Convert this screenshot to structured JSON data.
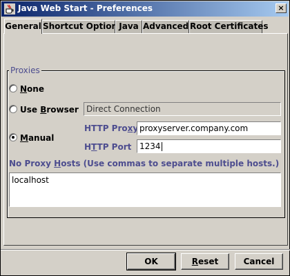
{
  "window": {
    "title": "Java Web Start - Preferences",
    "app_icon": "java-cup-icon",
    "close_glyph": "×"
  },
  "tabs": [
    {
      "label": "General",
      "selected": true
    },
    {
      "label": "Shortcut Options",
      "selected": false
    },
    {
      "label": "Java",
      "selected": false
    },
    {
      "label": "Advanced",
      "selected": false
    },
    {
      "label": "Root Certificates",
      "selected": false
    }
  ],
  "proxies": {
    "group_title": "Proxies",
    "selected": "Manual",
    "options": {
      "none": {
        "label_pre": "",
        "mnemonic": "N",
        "label_post": "one"
      },
      "browser": {
        "label_pre": "Use ",
        "mnemonic": "B",
        "label_post": "rowser"
      },
      "manual": {
        "label_pre": "",
        "mnemonic": "M",
        "label_post": "anual"
      }
    },
    "browser_value": "Direct Connection",
    "http_proxy": {
      "label_pre": "HTTP Pro",
      "mnemonic": "x",
      "label_post": "y",
      "value": "proxyserver.company.com"
    },
    "http_port": {
      "label_pre": "H",
      "mnemonic": "T",
      "label_post": "TP Port",
      "value": "1234"
    },
    "no_proxy": {
      "label_pre": "No Proxy ",
      "mnemonic": "H",
      "label_post": "osts (Use commas to separate multiple hosts.)",
      "value": "localhost"
    }
  },
  "buttons": {
    "ok": "OK",
    "reset_mnemonic": "R",
    "reset_rest": "eset",
    "cancel": "Cancel"
  },
  "colors": {
    "titlebar_start": "#0a246a",
    "titlebar_end": "#a6caf0",
    "label_accent": "#4d4d8f",
    "panel_bg": "#d4d0c8"
  }
}
